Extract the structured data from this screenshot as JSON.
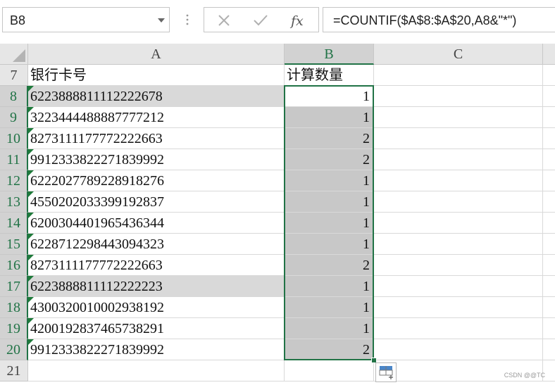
{
  "name_box": {
    "value": "B8"
  },
  "formula_bar": {
    "value": "=COUNTIF($A$8:$A$20,A8&\"*\")"
  },
  "columns": [
    "A",
    "B",
    "C"
  ],
  "rows": [
    {
      "num": "7",
      "a": "银行卡号",
      "b": "计算数量"
    },
    {
      "num": "8",
      "a": "6223888811112222678",
      "b": "1"
    },
    {
      "num": "9",
      "a": "3223444488887777212",
      "b": "1"
    },
    {
      "num": "10",
      "a": "8273111177772222663",
      "b": "2"
    },
    {
      "num": "11",
      "a": "9912333822271839992",
      "b": "2"
    },
    {
      "num": "12",
      "a": "6222027789228918276",
      "b": "1"
    },
    {
      "num": "13",
      "a": "4550202033399192837",
      "b": "1"
    },
    {
      "num": "14",
      "a": "6200304401965436344",
      "b": "1"
    },
    {
      "num": "15",
      "a": "6228712298443094323",
      "b": "1"
    },
    {
      "num": "16",
      "a": "8273111177772222663",
      "b": "2"
    },
    {
      "num": "17",
      "a": "6223888811112222223",
      "b": "1"
    },
    {
      "num": "18",
      "a": "4300320010002938192",
      "b": "1"
    },
    {
      "num": "19",
      "a": "4200192837465738291",
      "b": "1"
    },
    {
      "num": "20",
      "a": "9912333822271839992",
      "b": "2"
    },
    {
      "num": "21",
      "a": "",
      "b": ""
    }
  ],
  "watermark": "CSDN @@TC",
  "colors": {
    "selection": "#217346",
    "header": "#e6e6e6",
    "highlight": "#d9d9d9"
  }
}
